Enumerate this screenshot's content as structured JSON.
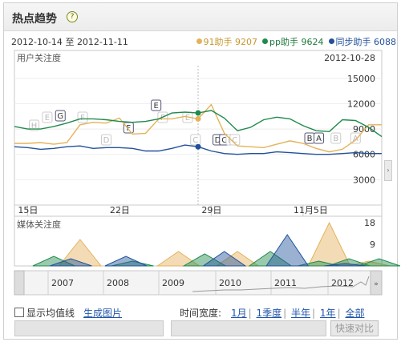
{
  "header": {
    "title": "热点趋势",
    "help_icon": "?"
  },
  "date_range": {
    "start": "2012-10-14",
    "sep": "至",
    "end": "2012-11-11"
  },
  "legend": [
    {
      "name": "91助手",
      "value": "9207",
      "color": "#e4b25a"
    },
    {
      "name": "pp助手",
      "value": "9624",
      "color": "#1f8a4c"
    },
    {
      "name": "同步助手",
      "value": "6088",
      "color": "#22519a"
    }
  ],
  "chart_data": [
    {
      "type": "line",
      "title": "用户关注度",
      "current_date": "2012-10-28",
      "x_tick_labels": [
        "15日",
        "22日",
        "29日",
        "11月5日"
      ],
      "y_tick_labels": [
        "15000",
        "12000",
        "9000",
        "6000",
        "3000"
      ],
      "ylim": [
        0,
        16500
      ],
      "x": [
        "10-14",
        "10-15",
        "10-16",
        "10-17",
        "10-18",
        "10-19",
        "10-20",
        "10-21",
        "10-22",
        "10-23",
        "10-24",
        "10-25",
        "10-26",
        "10-27",
        "10-28",
        "10-29",
        "10-30",
        "10-31",
        "11-01",
        "11-02",
        "11-03",
        "11-04",
        "11-05",
        "11-06",
        "11-07",
        "11-08",
        "11-09",
        "11-10",
        "11-11"
      ],
      "series": [
        {
          "name": "91助手",
          "color": "#e4b25a",
          "values": [
            7300,
            7300,
            7400,
            7200,
            7400,
            9500,
            9800,
            9700,
            10300,
            8400,
            8500,
            10200,
            10200,
            10500,
            10200,
            11900,
            8500,
            7000,
            6900,
            6800,
            7200,
            7600,
            7300,
            6700,
            6300,
            6600,
            7700,
            9500,
            9500
          ]
        },
        {
          "name": "pp助手",
          "color": "#1f8a4c",
          "values": [
            9300,
            9000,
            9000,
            9300,
            9700,
            10200,
            10200,
            10100,
            9900,
            9800,
            9900,
            10200,
            10900,
            11000,
            10900,
            11200,
            10300,
            8800,
            9200,
            10100,
            10400,
            10200,
            9400,
            8800,
            8700,
            10100,
            10000,
            9200,
            8100
          ]
        },
        {
          "name": "同步助手",
          "color": "#22519a",
          "values": [
            6900,
            6800,
            6600,
            6700,
            6900,
            7000,
            6700,
            6800,
            6800,
            6700,
            6400,
            6400,
            6700,
            7100,
            6900,
            6400,
            6100,
            6000,
            6100,
            6100,
            6300,
            6200,
            6100,
            6000,
            6000,
            6100,
            6200,
            6100,
            6100
          ]
        }
      ],
      "annotations": [
        {
          "letter": "H",
          "index": 1.5
        },
        {
          "letter": "G",
          "index": 3.5
        },
        {
          "letter": "F",
          "index": 8.7
        },
        {
          "letter": "E",
          "index": 10.8
        },
        {
          "letter": "E",
          "index": 2.5
        },
        {
          "letter": "F",
          "index": 5.2
        },
        {
          "letter": "D",
          "index": 7.0
        },
        {
          "letter": "F",
          "index": 11.3
        },
        {
          "letter": "E",
          "index": 13.2
        },
        {
          "letter": "C",
          "index": 13.8
        },
        {
          "letter": "D",
          "index": 15.5
        },
        {
          "letter": "C",
          "index": 16.0
        },
        {
          "letter": "D",
          "index": 16.5
        },
        {
          "letter": "C",
          "index": 16.8
        },
        {
          "letter": "B",
          "index": 22.5
        },
        {
          "letter": "A",
          "index": 23.2
        },
        {
          "letter": "B",
          "index": 24.5
        },
        {
          "letter": "A",
          "index": 26.0
        }
      ]
    },
    {
      "type": "area",
      "title": "媒体关注度",
      "y_tick_labels": [
        "18",
        "9"
      ],
      "ylim": [
        0,
        18
      ],
      "series": [
        {
          "name": "91助手",
          "color": "#e4b25a",
          "peaks": [
            {
              "i": 5,
              "v": 11
            },
            {
              "i": 12.5,
              "v": 6
            },
            {
              "i": 17,
              "v": 6
            },
            {
              "i": 24,
              "v": 18
            },
            {
              "i": 27,
              "v": 2
            }
          ]
        },
        {
          "name": "pp助手",
          "color": "#1f8a4c",
          "peaks": [
            {
              "i": 3,
              "v": 4
            },
            {
              "i": 9,
              "v": 2
            },
            {
              "i": 14.5,
              "v": 5
            },
            {
              "i": 19.5,
              "v": 6
            },
            {
              "i": 23.2,
              "v": 2
            },
            {
              "i": 25.5,
              "v": 3
            },
            {
              "i": 27.8,
              "v": 3
            }
          ]
        },
        {
          "name": "同步助手",
          "color": "#22519a",
          "peaks": [
            {
              "i": 4.3,
              "v": 3
            },
            {
              "i": 8.5,
              "v": 4
            },
            {
              "i": 16,
              "v": 6
            },
            {
              "i": 20.8,
              "v": 13
            },
            {
              "i": 25.2,
              "v": 1
            }
          ]
        }
      ]
    }
  ],
  "overview": {
    "years": [
      "2007",
      "2008",
      "2009",
      "2010",
      "2011",
      "2012"
    ]
  },
  "controls": {
    "show_avg_label": "显示均值线",
    "gen_image_label": "生成图片",
    "time_width_label": "时间宽度:",
    "ranges": [
      "1月",
      "1季度",
      "半年",
      "1年",
      "全部"
    ]
  },
  "compare_button": "快速对比"
}
